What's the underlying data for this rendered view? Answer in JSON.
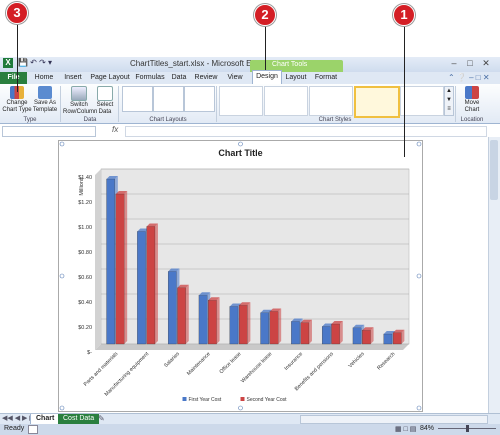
{
  "window": {
    "title": "ChartTitles_start.xlsx - Microsoft Excel",
    "context_tab_group": "Chart Tools"
  },
  "tabs": [
    "File",
    "Home",
    "Insert",
    "Page Layout",
    "Formulas",
    "Data",
    "Review",
    "View",
    "Design",
    "Layout",
    "Format"
  ],
  "active_tab": "Design",
  "ribbon": {
    "change_chart_type": "Change Chart Type",
    "save_as_template": "Save As Template",
    "switch_row_column": "Switch Row/Column",
    "select_data": "Select Data",
    "move_chart": "Move Chart",
    "group_type": "Type",
    "group_data": "Data",
    "group_chart_layouts": "Chart Layouts",
    "group_chart_styles": "Chart Styles",
    "group_location": "Location"
  },
  "formula_bar": {
    "fx": "fx",
    "value": ""
  },
  "callouts": [
    "3",
    "2",
    "1"
  ],
  "chart_data": {
    "type": "bar",
    "title": "Chart Title",
    "ylabel": "Millions",
    "ylim": [
      0,
      1.4
    ],
    "yticks": [
      "$-",
      "$0.20",
      "$0.40",
      "$0.60",
      "$0.80",
      "$1.00",
      "$1.20",
      "$1.40"
    ],
    "categories": [
      "Parts and materials",
      "Manufacturing equipment",
      "Salaries",
      "Maintenance",
      "Office lease",
      "Warehouse lease",
      "Insurance",
      "Benefits and pensions",
      "Vehicles",
      "Research"
    ],
    "series": [
      {
        "name": "First Year Cost",
        "color": "#4a78c8",
        "values": [
          1.32,
          0.9,
          0.58,
          0.39,
          0.3,
          0.25,
          0.18,
          0.14,
          0.13,
          0.08
        ]
      },
      {
        "name": "Second Year Cost",
        "color": "#cc4444",
        "values": [
          1.2,
          0.94,
          0.45,
          0.35,
          0.31,
          0.26,
          0.17,
          0.16,
          0.11,
          0.09
        ]
      }
    ],
    "grid": true,
    "legend": "bottom"
  },
  "sheet_tabs": [
    "Chart",
    "Cost Data"
  ],
  "status": {
    "ready": "Ready",
    "zoom": "84%"
  }
}
